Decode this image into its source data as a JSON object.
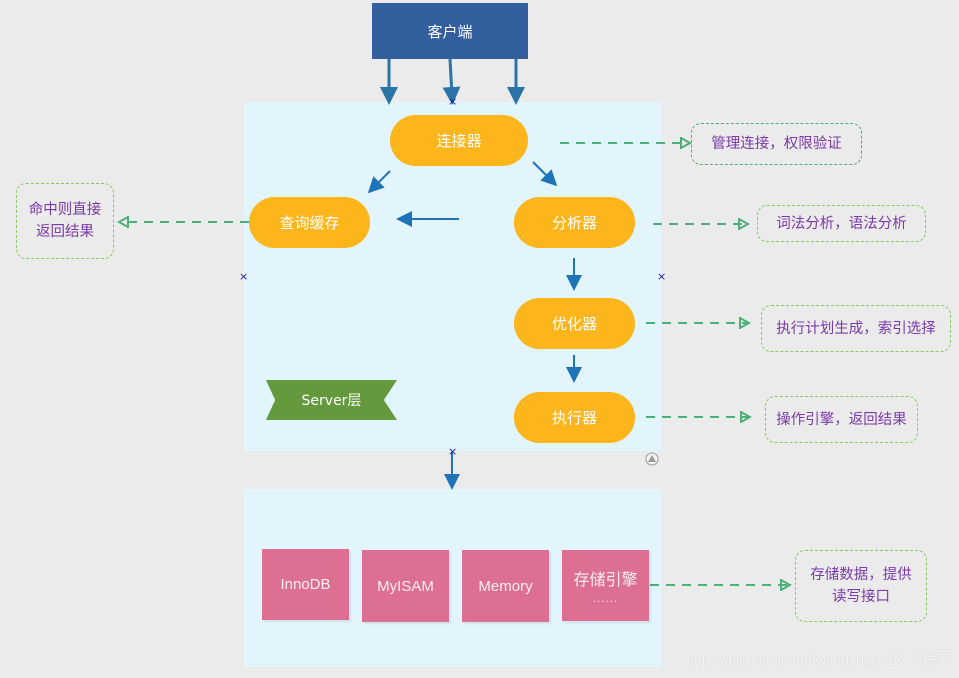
{
  "client": {
    "label": "客户端"
  },
  "server": {
    "tag": "Server层",
    "nodes": {
      "connector": "连接器",
      "query_cache": "查询缓存",
      "analyzer": "分析器",
      "optimizer": "优化器",
      "executor": "执行器"
    }
  },
  "notes": {
    "connector": "管理连接，权限验证",
    "query_cache_line1": "命中则直接",
    "query_cache_line2": "返回结果",
    "analyzer": "词法分析，语法分析",
    "optimizer": "执行计划生成，索引选择",
    "executor": "操作引擎，返回结果",
    "engine_line1": "存储数据，提供",
    "engine_line2": "读写接口"
  },
  "engines": {
    "items": [
      "InnoDB",
      "MyISAM",
      "Memory"
    ],
    "more_label": "存储引擎",
    "more_ellipsis": "......"
  },
  "markers": {
    "x": "×"
  },
  "watermark": "https://blog.csdn.net/wangyu@51CTO博客",
  "colors": {
    "client": "#335f9f",
    "pill": "#fcb51a",
    "engine": "#dc6f92",
    "server_tag": "#65993d",
    "arrow": "#1f74b8",
    "dash": "#4caf77",
    "note_text": "#7a3aa8"
  }
}
